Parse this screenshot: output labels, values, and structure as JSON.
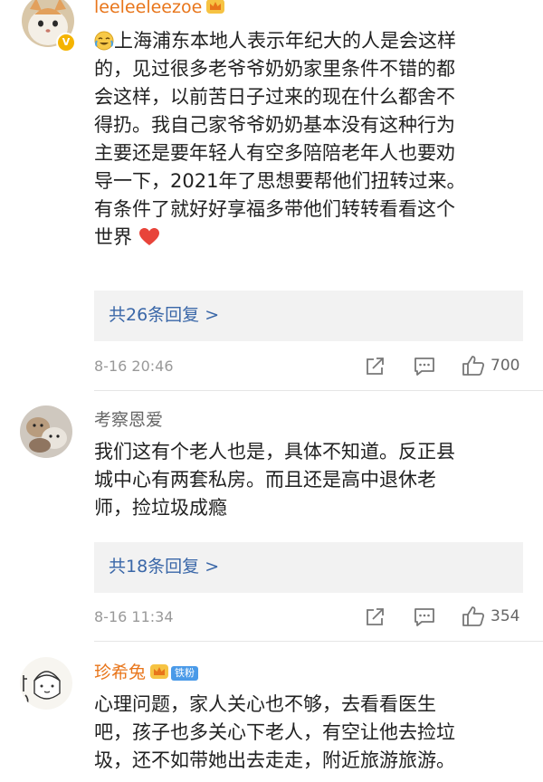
{
  "comments": [
    {
      "username": "leeleeleezoe",
      "content_lines": [
        "上海浦东本地人表示年纪大的人是会这样",
        "的，见过很多老爷爷奶奶家里条件不错的都",
        "会这样，以前苦日子过来的现在什么都舍不",
        "得扔。我自己家爷爷奶奶基本没有这种行为",
        "主要还是要年轻人有空多陪陪老年人也要劝",
        "导一下，2021年了思想要帮他们扭转过来。",
        "有条件了就好好享福多带他们转转看看这个",
        "世界"
      ],
      "reply_label": "共26条回复 >",
      "time": "8-16 20:46",
      "likes": "700"
    },
    {
      "username": "考察恩爱",
      "content_lines": [
        "我们这有个老人也是，具体不知道。反正县",
        "城中心有两套私房。而且还是高中退休老",
        "师，捡垃圾成瘾"
      ],
      "reply_label": "共18条回复 >",
      "time": "8-16 11:34",
      "likes": "354"
    },
    {
      "username": "珍希兔",
      "fan_badge": "铁粉",
      "content_lines": [
        "心理问题，家人关心也不够，去看看医生",
        "吧，孩子也多关心下老人，有空让他去捡垃",
        "圾，还不如带她出去走走，附近旅游旅游。"
      ]
    }
  ],
  "icons": {
    "crying_emoji": "crying-laughing-emoji",
    "heart_emoji": "red-heart-emoji",
    "share": "share-icon",
    "comment": "comment-icon",
    "like": "thumbs-up-icon"
  },
  "colors": {
    "username_vip": "#e8751a",
    "username_plain": "#666666",
    "reply_link": "#3a67a8",
    "reply_bg": "#f2f2f2"
  }
}
